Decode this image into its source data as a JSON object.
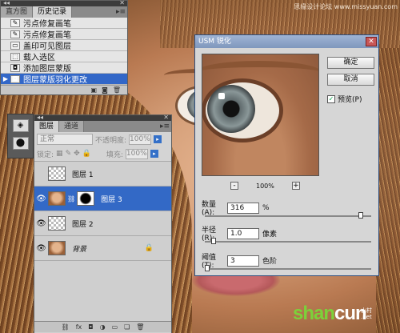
{
  "watermark_top": "思缘设计论坛 www.missyuan.com",
  "watermark": {
    "part1": "shan",
    "part2": "cun",
    "suffix": "山村 .net"
  },
  "history": {
    "tabs": [
      "直方图",
      "历史记录"
    ],
    "items": [
      {
        "label": "污点修复画笔"
      },
      {
        "label": "污点修复画笔"
      },
      {
        "label": "盖印可见图层"
      },
      {
        "label": "载入选区"
      },
      {
        "label": "添加图层蒙版"
      },
      {
        "label": "图层蒙版羽化更改",
        "selected": true
      }
    ]
  },
  "layers": {
    "tabs": [
      "图层",
      "通道"
    ],
    "blend_mode": "正常",
    "opacity_label": "不透明度:",
    "opacity_value": "100%",
    "lock_label": "锁定:",
    "fill_label": "填充:",
    "fill_value": "100%",
    "items": [
      {
        "name": "图层 1",
        "visible": false
      },
      {
        "name": "图层 3",
        "visible": true,
        "selected": true
      },
      {
        "name": "图层 2",
        "visible": true
      },
      {
        "name": "背景",
        "visible": true,
        "locked": true
      }
    ],
    "footer_icons": [
      "link-icon",
      "fx-icon",
      "mask-icon",
      "adjustment-icon",
      "group-icon",
      "new-layer-icon",
      "trash-icon"
    ]
  },
  "usm": {
    "title": "USM 锐化",
    "ok_label": "确定",
    "cancel_label": "取消",
    "preview_label": "预览(P)",
    "preview_checked": true,
    "zoom_out": "-",
    "zoom_value": "100%",
    "zoom_in": "+",
    "amount": {
      "label": "数量(A):",
      "value": "316",
      "unit": "%",
      "level": 0.95
    },
    "radius": {
      "label": "半径(R):",
      "value": "1.0",
      "unit": "像素",
      "level": 0.04
    },
    "threshold": {
      "label": "阈值(T):",
      "value": "3",
      "unit": "色阶",
      "level": 0.0
    }
  }
}
